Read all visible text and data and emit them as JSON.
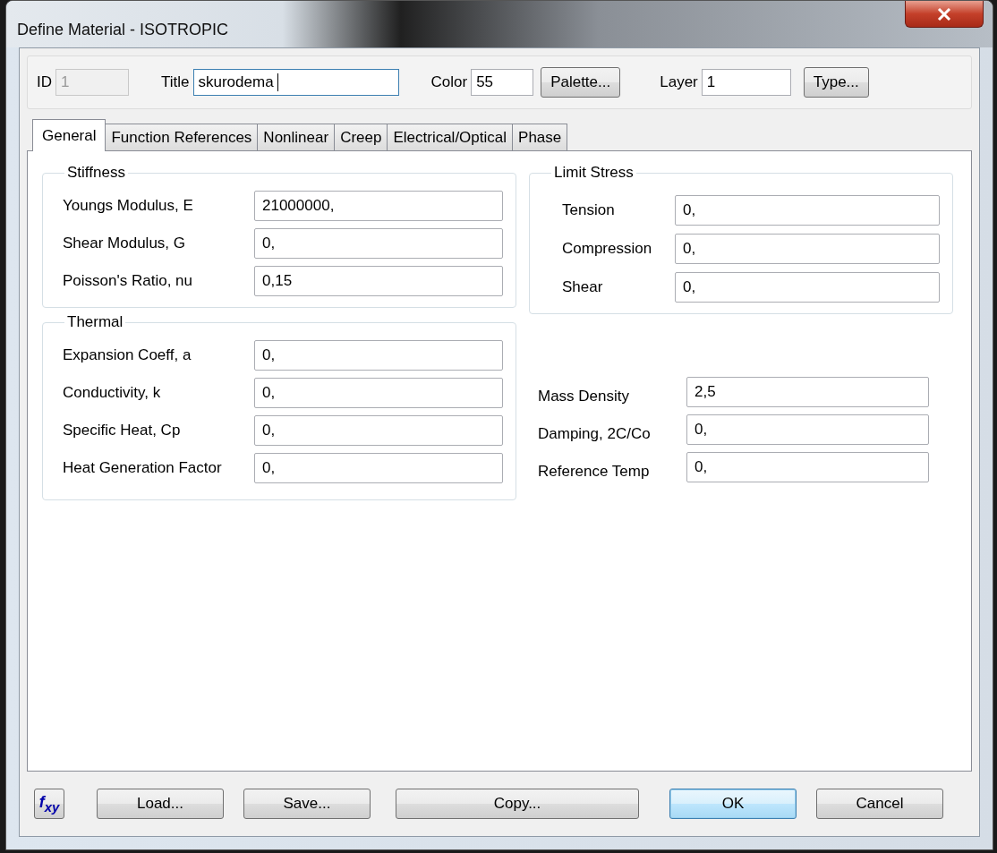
{
  "window": {
    "title": "Define Material - ISOTROPIC"
  },
  "header": [
    {
      "kind": "field",
      "label": "ID",
      "value": "1",
      "disabled": true,
      "focused": false
    },
    {
      "kind": "field",
      "label": "Title",
      "value": "skurodema",
      "disabled": false,
      "focused": true
    },
    {
      "kind": "field",
      "label": "Color",
      "value": "55",
      "disabled": false,
      "focused": false
    },
    {
      "kind": "button",
      "label": "Palette..."
    },
    {
      "kind": "field",
      "label": "Layer",
      "value": "1",
      "disabled": false,
      "focused": false
    },
    {
      "kind": "button",
      "label": "Type..."
    }
  ],
  "tabs": [
    {
      "label": "General",
      "selected": true
    },
    {
      "label": "Function References",
      "selected": false
    },
    {
      "label": "Nonlinear",
      "selected": false
    },
    {
      "label": "Creep",
      "selected": false
    },
    {
      "label": "Electrical/Optical",
      "selected": false
    },
    {
      "label": "Phase",
      "selected": false
    }
  ],
  "stiffness": {
    "title": "Stiffness",
    "rows": [
      {
        "label": "Youngs Modulus, E",
        "value": "21000000,"
      },
      {
        "label": "Shear Modulus, G",
        "value": "0,"
      },
      {
        "label": "Poisson's Ratio, nu",
        "value": "0,15"
      }
    ]
  },
  "limit_stress": {
    "title": "Limit Stress",
    "rows": [
      {
        "label": "Tension",
        "value": "0,"
      },
      {
        "label": "Compression",
        "value": "0,"
      },
      {
        "label": "Shear",
        "value": "0,"
      }
    ]
  },
  "thermal": {
    "title": "Thermal",
    "rows": [
      {
        "label": "Expansion Coeff, a",
        "value": "0,"
      },
      {
        "label": "Conductivity, k",
        "value": "0,"
      },
      {
        "label": "Specific Heat, Cp",
        "value": "0,"
      },
      {
        "label": "Heat Generation Factor",
        "value": "0,"
      }
    ]
  },
  "other": [
    {
      "label": "Mass Density",
      "value": "2,5"
    },
    {
      "label": "Damping, 2C/Co",
      "value": "0,"
    },
    {
      "label": "Reference Temp",
      "value": "0,"
    }
  ],
  "function_button": {
    "label": "f$_{xy}$"
  },
  "buttons": [
    {
      "label": "Load...",
      "default": false
    },
    {
      "label": "Save...",
      "default": false
    },
    {
      "label": "Copy...",
      "default": false
    },
    {
      "label": "OK",
      "default": true
    },
    {
      "label": "Cancel",
      "default": false
    }
  ]
}
